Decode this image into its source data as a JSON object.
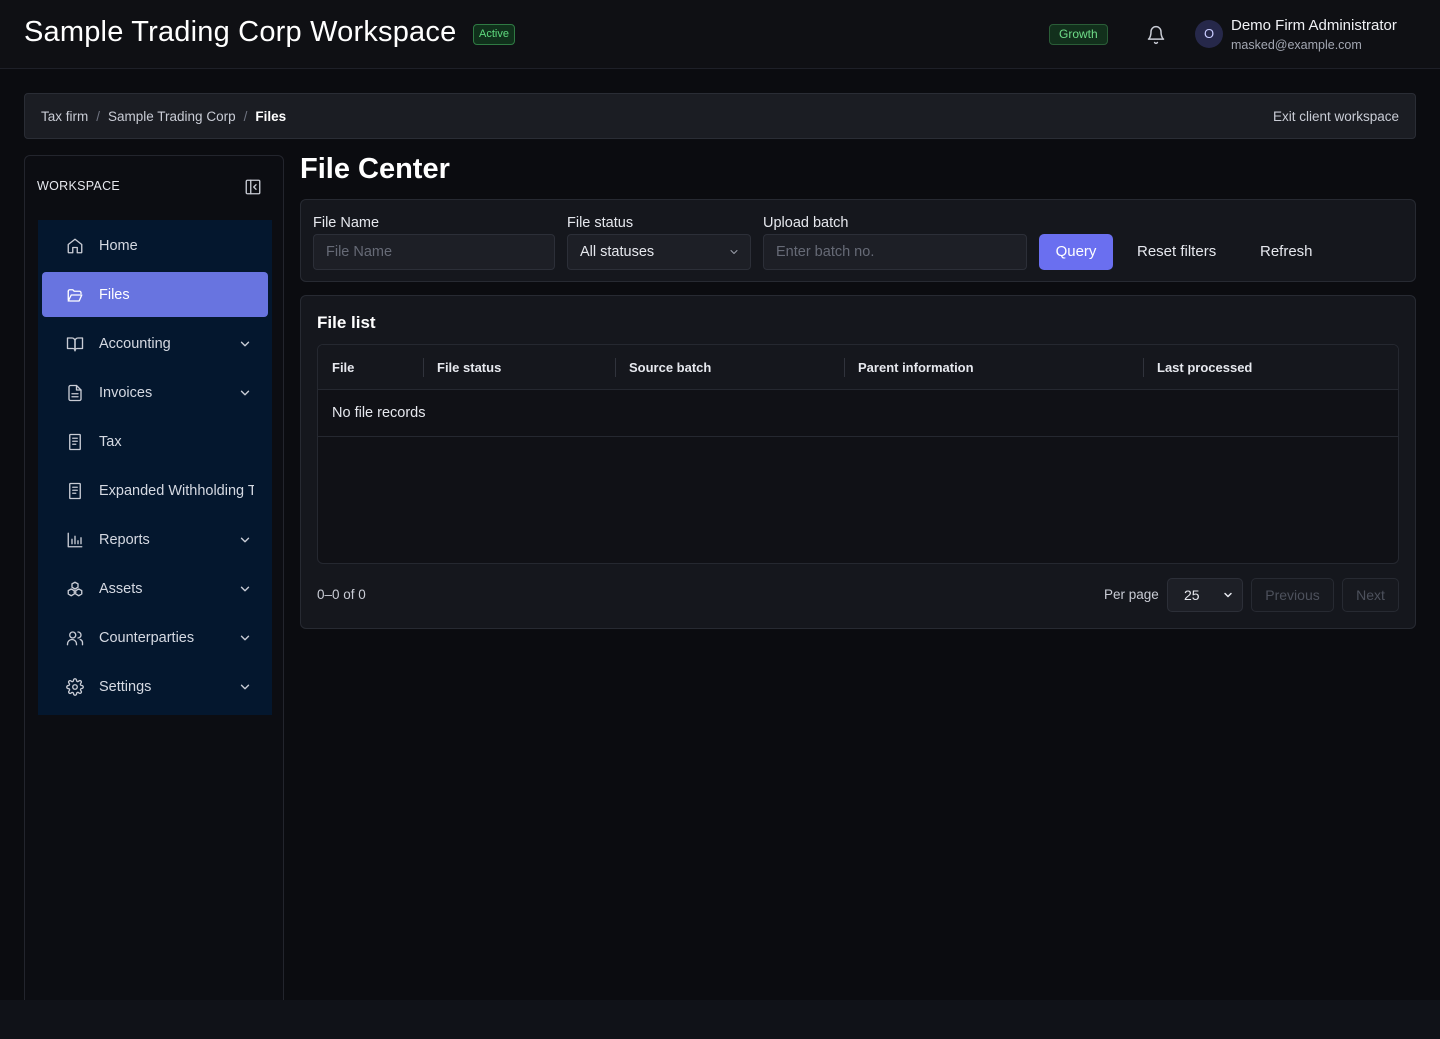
{
  "header": {
    "title": "Sample Trading Corp Workspace",
    "status_badge": "Active",
    "plan_badge": "Growth",
    "notifications_icon": "bell-icon",
    "user": {
      "avatar_initial": "O",
      "name": "Demo Firm Administrator",
      "email": "masked@example.com"
    }
  },
  "breadcrumb": {
    "items": [
      "Tax firm",
      "Sample Trading Corp",
      "Files"
    ],
    "separator": "/",
    "exit_label": "Exit client workspace"
  },
  "sidebar": {
    "title": "WORKSPACE",
    "collapse_icon": "sidebar-collapse-icon",
    "items": [
      {
        "label": "Home",
        "icon": "home-icon",
        "expandable": false,
        "active": false
      },
      {
        "label": "Files",
        "icon": "folder-open-icon",
        "expandable": false,
        "active": true
      },
      {
        "label": "Accounting",
        "icon": "book-open-icon",
        "expandable": true,
        "active": false
      },
      {
        "label": "Invoices",
        "icon": "file-text-icon",
        "expandable": true,
        "active": false
      },
      {
        "label": "Tax",
        "icon": "receipt-icon",
        "expandable": false,
        "active": false
      },
      {
        "label": "Expanded Withholding Tax",
        "icon": "receipt-icon",
        "expandable": false,
        "active": false
      },
      {
        "label": "Reports",
        "icon": "bar-chart-icon",
        "expandable": true,
        "active": false
      },
      {
        "label": "Assets",
        "icon": "boxes-icon",
        "expandable": true,
        "active": false
      },
      {
        "label": "Counterparties",
        "icon": "users-icon",
        "expandable": true,
        "active": false
      },
      {
        "label": "Settings",
        "icon": "gear-icon",
        "expandable": true,
        "active": false
      }
    ]
  },
  "main": {
    "page_title": "File Center",
    "filters": {
      "file_name": {
        "label": "File Name",
        "placeholder": "File Name",
        "value": ""
      },
      "file_status": {
        "label": "File status",
        "value": "All statuses"
      },
      "upload_batch": {
        "label": "Upload batch",
        "placeholder": "Enter batch no.",
        "value": ""
      },
      "query_label": "Query",
      "reset_label": "Reset filters",
      "refresh_label": "Refresh"
    },
    "file_list": {
      "title": "File list",
      "columns": [
        "File",
        "File status",
        "Source batch",
        "Parent information",
        "Last processed"
      ],
      "empty_text": "No file records",
      "range_text": "0–0 of 0",
      "per_page_label": "Per page",
      "per_page_value": "25",
      "previous_label": "Previous",
      "next_label": "Next"
    }
  },
  "colors": {
    "accent": "#6a6ff0",
    "active_nav": "#6874e0",
    "nav_background": "#04172e",
    "status_green": "#5fd97e",
    "page_background": "#0b0c10"
  }
}
